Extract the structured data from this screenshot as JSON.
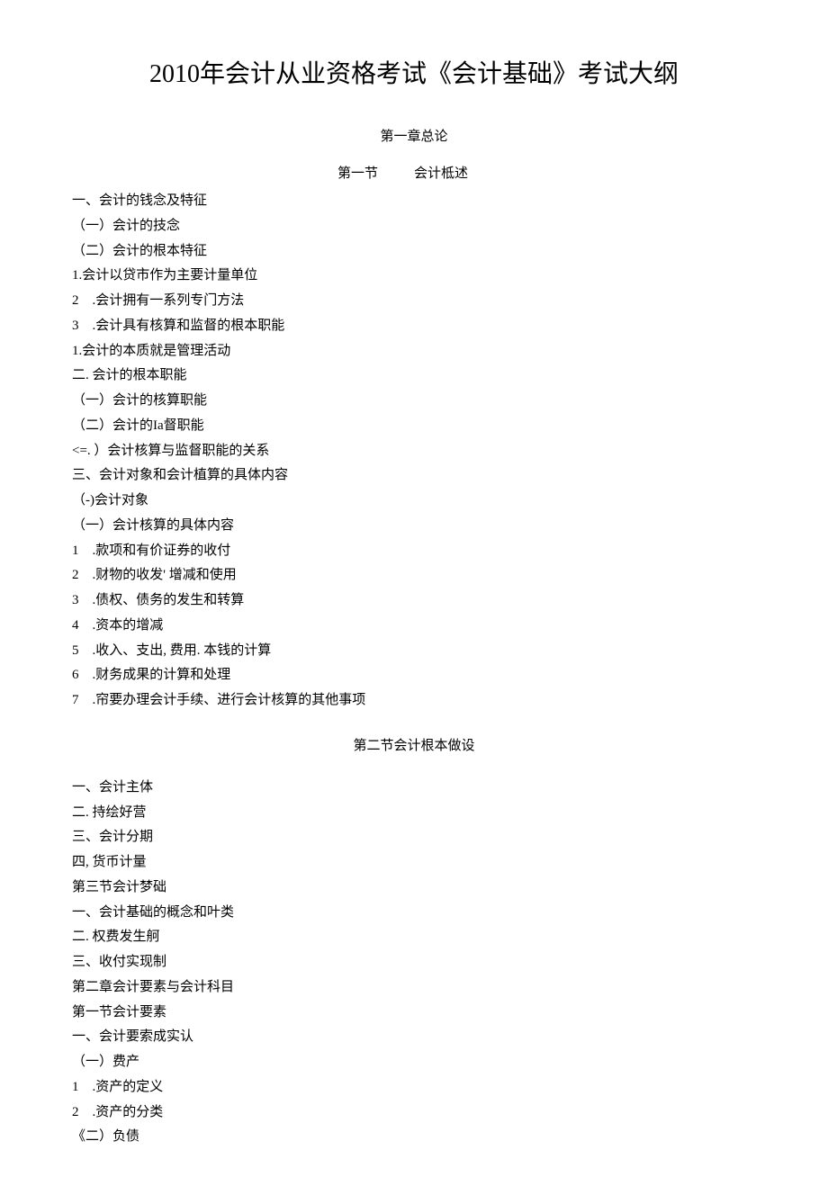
{
  "title": "2010年会计从业资格考试《会计基础》考试大纲",
  "chapter1": "第一章总论",
  "section1_label": "第一节",
  "section1_name": "会计柢述",
  "lines1": [
    "一、会计的钱念及特征",
    "（一）会计的技念",
    "（二）会计的根本特征",
    "1.会计以贷市作为主要计量单位",
    "2　.会计拥有一系列专门方法",
    "3　.会计具有核算和监督的根本职能",
    "1.会计的本质就是管理活动",
    "二. 会计的根本职能",
    "（一）会计的核算职能",
    "（二）会计的Ia督职能",
    "<=. ）会计核算与监督职能的关系",
    "三、会计对象和会计植算的具体内容",
    "（-)会计对象",
    "（一）会计核算的具体内容",
    "1　.款项和有价证券的收付",
    "2　.财物的收发' 增减和使用",
    "3　.债权、债务的发生和转算",
    "4　.资本的增减",
    "5　.收入、支出, 费用. 本钱的计算",
    "6　.财务成果的计算和处理",
    "7　.帘要办理会计手续、进行会计核算的其他事项"
  ],
  "section2": "第二节会计根本做设",
  "lines2": [
    "一、会计主体",
    "二. 持绘好营",
    "三、会计分期",
    "四, 货币计量",
    "第三节会计梦础",
    "一、会计基础的概念和叶类",
    "二. 权费发生舸",
    "三、收付实现制",
    "第二章会计要素与会计科目",
    "第一节会计要素",
    "一、会计要索成实认",
    "（一）费产",
    "1　.资产的定义",
    "2　.资产的分类",
    "《二）负债"
  ]
}
